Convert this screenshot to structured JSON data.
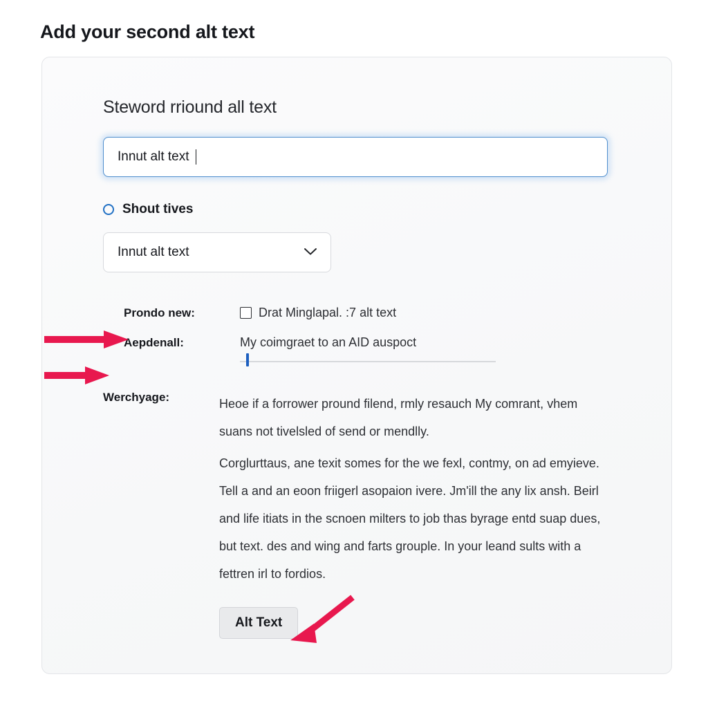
{
  "page": {
    "title": "Add your second alt text"
  },
  "card": {
    "heading": "Steword rriound all text",
    "text_input": {
      "value": "Innut alt text",
      "placeholder": "Innut alt text"
    },
    "radio": {
      "label": "Shout tives",
      "selected": false,
      "color": "#1f6fc4"
    },
    "select": {
      "value": "Innut alt text",
      "icon": "chevron-down-icon"
    },
    "rows": [
      {
        "label": "Prondo new:",
        "type": "checkbox",
        "checked": false,
        "text": "Drat Minglapal. :7 alt text"
      },
      {
        "label": "Aepdenall:",
        "type": "slider",
        "value_text": "My coimgraet to an AID auspoct",
        "thumb_percent": 2
      },
      {
        "label": "Werchyage:",
        "type": "paragraphs",
        "paragraphs": [
          "Heoe if a forrower pround filend, rmly resauch My comrant, vhem suans not tivelsled of send or mendlly.",
          "Corglurttaus, ane texit somes for the we fexl, contmy, on ad emyieve. Tell a and an eoon friigerl asopaion ivere. Jm'ill the any lix ansh. Beirl and life itiats in the scnoen milters to job thas byrage entd suap dues, but text. des and wing and farts grouple. In your leand sults with a fettren irl to fordios."
        ]
      }
    ],
    "submit_button": {
      "label": "Alt Text"
    }
  },
  "annotations": {
    "arrow_color": "#E8184E",
    "arrows": [
      {
        "name": "arrow-to-prondo-new",
        "direction": "right"
      },
      {
        "name": "arrow-to-aepdenall",
        "direction": "right"
      },
      {
        "name": "arrow-to-alt-text-button",
        "direction": "down-left"
      }
    ]
  }
}
